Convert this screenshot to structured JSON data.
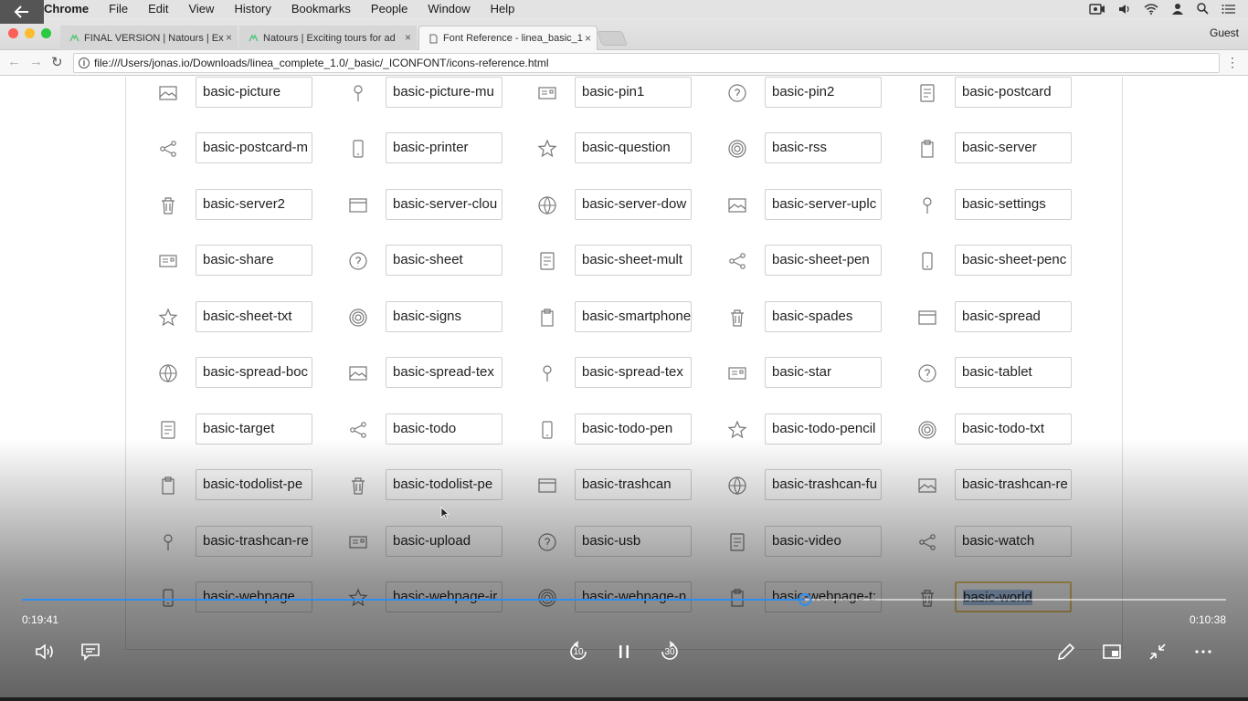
{
  "menubar": {
    "app": "Chrome",
    "items": [
      "File",
      "Edit",
      "View",
      "History",
      "Bookmarks",
      "People",
      "Window",
      "Help"
    ]
  },
  "tabs": [
    {
      "title": "FINAL VERSION | Natours | Ex"
    },
    {
      "title": "Natours | Exciting tours for ad"
    },
    {
      "title": "Font Reference - linea_basic_1"
    }
  ],
  "profile": "Guest",
  "url": "file:///Users/jonas.io/Downloads/linea_complete_1.0/_basic/_ICONFONT/icons-reference.html",
  "icons": [
    [
      "basic-picture",
      "basic-picture-mu",
      "basic-pin1",
      "basic-pin2",
      "basic-postcard"
    ],
    [
      "basic-postcard-m",
      "basic-printer",
      "basic-question",
      "basic-rss",
      "basic-server"
    ],
    [
      "basic-server2",
      "basic-server-clou",
      "basic-server-dow",
      "basic-server-uplc",
      "basic-settings"
    ],
    [
      "basic-share",
      "basic-sheet",
      "basic-sheet-mult",
      "basic-sheet-pen",
      "basic-sheet-penc"
    ],
    [
      "basic-sheet-txt",
      "basic-signs",
      "basic-smartphone",
      "basic-spades",
      "basic-spread"
    ],
    [
      "basic-spread-boc",
      "basic-spread-tex",
      "basic-spread-tex",
      "basic-star",
      "basic-tablet"
    ],
    [
      "basic-target",
      "basic-todo",
      "basic-todo-pen",
      "basic-todo-pencil",
      "basic-todo-txt"
    ],
    [
      "basic-todolist-pe",
      "basic-todolist-pe",
      "basic-trashcan",
      "basic-trashcan-fu",
      "basic-trashcan-re"
    ],
    [
      "basic-trashcan-re",
      "basic-upload",
      "basic-usb",
      "basic-video",
      "basic-watch"
    ],
    [
      "basic-webpage",
      "basic-webpage-ir",
      "basic-webpage-n",
      "basic-webpage-t:",
      "basic-world"
    ]
  ],
  "player": {
    "current_time": "0:19:41",
    "total_time": "0:10:38",
    "progress_fraction": 0.65,
    "accent": "#2e8ef0"
  }
}
